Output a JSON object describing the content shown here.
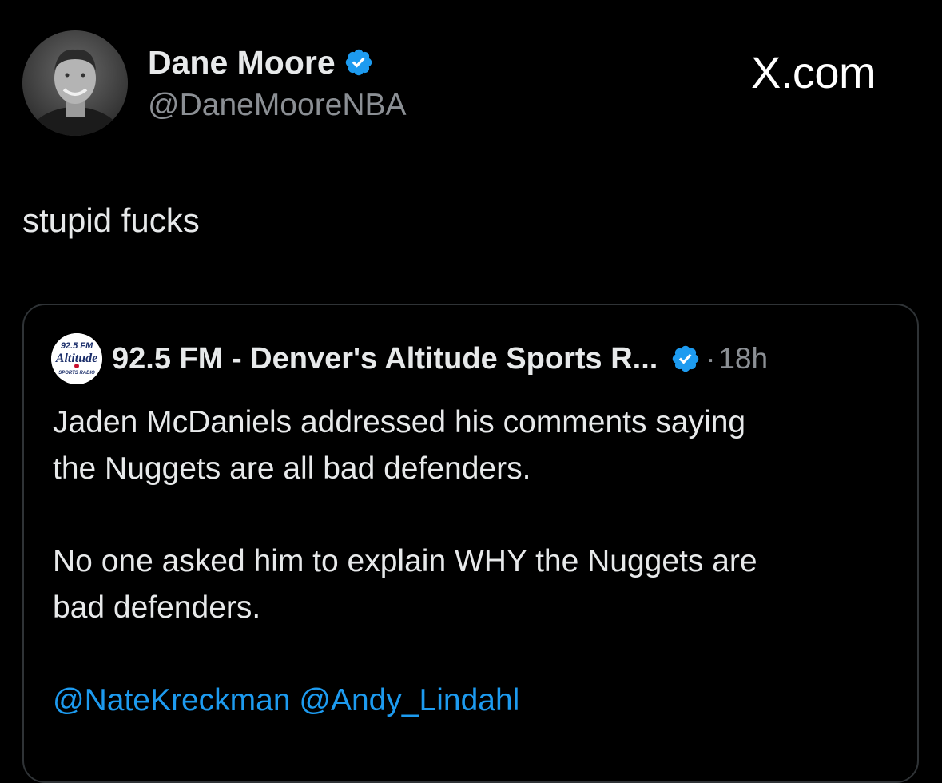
{
  "author": {
    "name": "Dane Moore",
    "handle": "@DaneMooreNBA",
    "verified": true,
    "avatar_icon": "profile-photo"
  },
  "site_logo": "X.com",
  "tweet": {
    "text": "stupid fucks"
  },
  "quoted_tweet": {
    "author_name": "92.5 FM - Denver's Altitude Sports R...",
    "verified": true,
    "separator": "·",
    "time": "18h",
    "avatar": {
      "line1": "92.5 FM",
      "line2": "Altitude",
      "line3": "SPORTS RADIO"
    },
    "body_line1": "Jaden McDaniels addressed his comments saying",
    "body_line2": "the Nuggets are all bad defenders.",
    "body_line3": "No one asked him to explain WHY the Nuggets are",
    "body_line4": "bad defenders.",
    "mention1": "@NateKreckman",
    "mention2": "@Andy_Lindahl"
  },
  "colors": {
    "background": "#000000",
    "text": "#e7e9ea",
    "secondary": "#8b8f94",
    "accent": "#1d9bf0",
    "border": "#2f3336"
  }
}
